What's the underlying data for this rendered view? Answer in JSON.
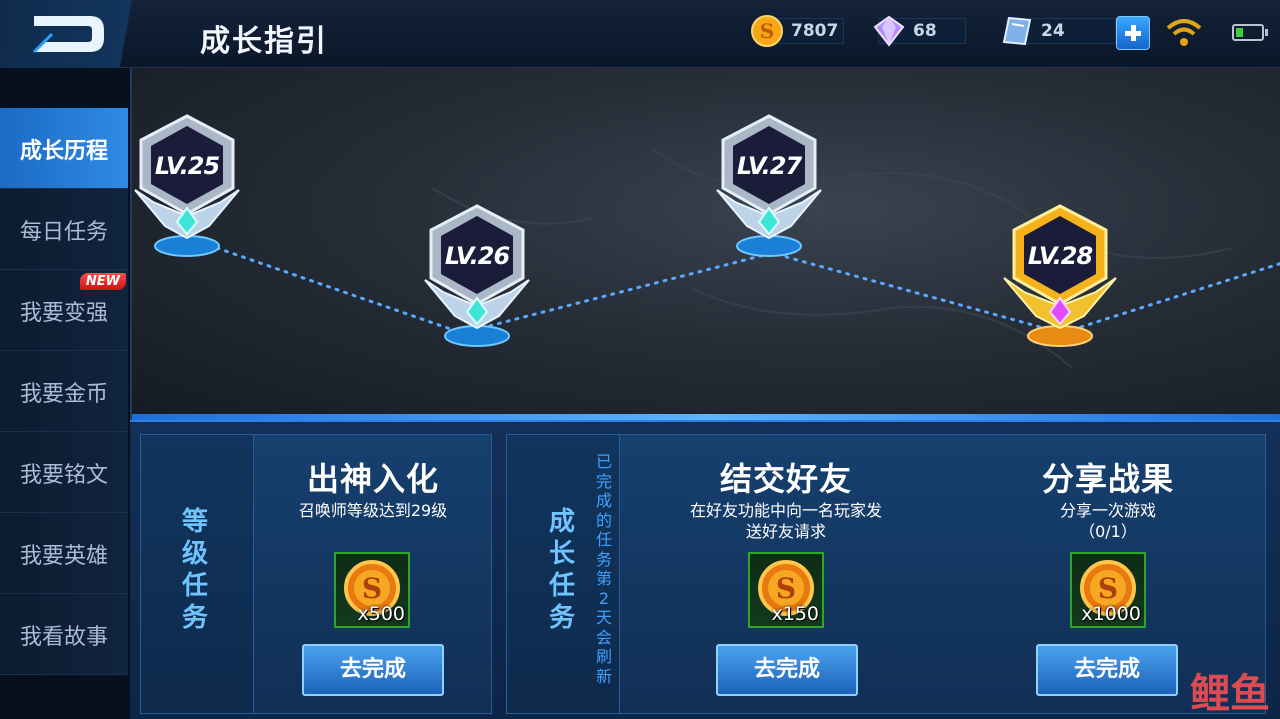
{
  "header": {
    "title": "成长指引"
  },
  "currencies": {
    "gold": "7807",
    "diamond": "68",
    "coupon": "24"
  },
  "sidebar": {
    "items": [
      {
        "label": "成长历程",
        "active": true
      },
      {
        "label": "每日任务"
      },
      {
        "label": "我要变强",
        "badge": "NEW"
      },
      {
        "label": "我要金币"
      },
      {
        "label": "我要铭文"
      },
      {
        "label": "我要英雄"
      },
      {
        "label": "我看故事"
      }
    ]
  },
  "levels": [
    {
      "label": "LV.25",
      "state": "done"
    },
    {
      "label": "LV.26",
      "state": "done"
    },
    {
      "label": "LV.27",
      "state": "done"
    },
    {
      "label": "LV.28",
      "state": "current"
    }
  ],
  "level_tasks": {
    "section_label": [
      "等",
      "级",
      "任",
      "务"
    ],
    "task": {
      "title": "出神入化",
      "desc": "召唤师等级达到29级",
      "reward_qty": "x500",
      "button": "去完成"
    }
  },
  "growth_tasks": {
    "section_label": [
      "成",
      "长",
      "任",
      "务"
    ],
    "note": [
      "已",
      "完",
      "成",
      "的",
      "任",
      "务",
      "第",
      "2",
      "天",
      "会",
      "刷",
      "新"
    ],
    "tasks": [
      {
        "title": "结交好友",
        "desc": "在好友功能中向一名玩家发",
        "desc2": "送好友请求",
        "reward_qty": "x150",
        "button": "去完成"
      },
      {
        "title": "分享战果",
        "desc": "分享一次游戏",
        "desc2": "（0/1）",
        "reward_qty": "x1000",
        "button": "去完成"
      }
    ]
  },
  "watermark": "鲤鱼",
  "colors": {
    "accent": "#2f8ae6",
    "gold": "#f6b21a",
    "reward_border": "#2ca72c"
  }
}
